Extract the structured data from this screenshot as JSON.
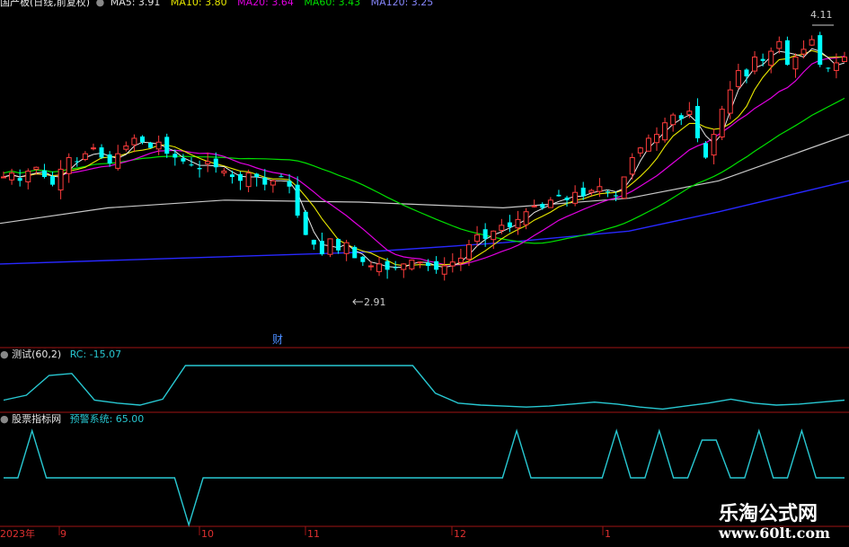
{
  "main_panel": {
    "title": "国产板(日线,前复权)",
    "ma_items": [
      {
        "label": "MA5: 3.91",
        "color": "#e8e8e8"
      },
      {
        "label": "MA10: 3.80",
        "color": "#e8e800"
      },
      {
        "label": "MA20: 3.64",
        "color": "#e000e0"
      },
      {
        "label": "MA60: 3.43",
        "color": "#00e000"
      },
      {
        "label": "MA120: 3.25",
        "color": "#8888ff"
      }
    ],
    "high_label": "4.11",
    "low_label": "2.91",
    "fin_marker": "财"
  },
  "rc_panel": {
    "title": "测试(60,2)",
    "value_label": "RC: -15.07",
    "color": "#28c8d2"
  },
  "warn_panel": {
    "title": "股票指标网",
    "value_label": "预警系统: 65.00",
    "color": "#28c8d2"
  },
  "time_axis": {
    "labels": [
      "2023年",
      "9",
      "10",
      "11",
      "12",
      "1"
    ]
  },
  "watermark": {
    "line1": "乐淘公式网",
    "line2": "www.60lt.com"
  },
  "colors": {
    "up": "#ff3c3c",
    "down": "#00ffff",
    "grid": "#a01414",
    "ma5": "#e8e8e8",
    "ma10": "#e8e800",
    "ma20": "#e000e0",
    "ma60": "#00e000",
    "ma120": "#2828ff",
    "ma250": "#c8c8c8",
    "indicator": "#28c8d2"
  },
  "chart_data": [
    {
      "type": "candlestick",
      "title": "国产板(日线,前复权)",
      "x_labels": [
        "2023年",
        "9",
        "10",
        "11",
        "12",
        "1"
      ],
      "y_labels_shown": [
        "4.11",
        "2.91"
      ],
      "close_path": [
        3.4,
        3.42,
        3.38,
        3.43,
        3.45,
        3.4,
        3.36,
        3.44,
        3.5,
        3.48,
        3.52,
        3.55,
        3.5,
        3.47,
        3.52,
        3.56,
        3.6,
        3.58,
        3.55,
        3.58,
        3.52,
        3.5,
        3.48,
        3.46,
        3.44,
        3.48,
        3.45,
        3.43,
        3.4,
        3.38,
        3.42,
        3.4,
        3.36,
        3.38,
        3.4,
        3.35,
        3.2,
        3.1,
        3.05,
        3.0,
        3.08,
        3.02,
        3.06,
        2.98,
        2.96,
        2.94,
        2.95,
        2.92,
        2.93,
        2.95,
        2.97,
        2.96,
        2.94,
        2.92,
        2.94,
        2.96,
        2.98,
        3.05,
        3.1,
        3.08,
        3.12,
        3.15,
        3.14,
        3.18,
        3.22,
        3.25,
        3.24,
        3.28,
        3.3,
        3.28,
        3.32,
        3.3,
        3.33,
        3.35,
        3.32,
        3.3,
        3.4,
        3.5,
        3.55,
        3.6,
        3.62,
        3.68,
        3.72,
        3.7,
        3.74,
        3.6,
        3.5,
        3.62,
        3.75,
        3.85,
        3.95,
        3.92,
        4.02,
        4.0,
        4.05,
        4.1,
        3.98,
        4.02,
        4.06,
        4.11,
        3.98,
        3.96,
        3.99,
        4.02
      ],
      "series_lines": [
        "MA5",
        "MA10",
        "MA20",
        "MA60",
        "MA120",
        "MA250"
      ]
    },
    {
      "type": "line",
      "title": "测试(60,2)",
      "series": [
        {
          "name": "RC",
          "values": [
            -15,
            -10,
            10,
            12,
            -15,
            -18,
            -20,
            -14,
            20,
            20,
            20,
            20,
            20,
            20,
            20,
            20,
            20,
            20,
            20,
            -8,
            -18,
            -20,
            -21,
            -22,
            -21,
            -19,
            -17,
            -19,
            -22,
            -24,
            -21,
            -18,
            -14,
            -18,
            -20,
            -19,
            -17,
            -15
          ]
        }
      ]
    },
    {
      "type": "line",
      "title": "股票指标网",
      "series": [
        {
          "name": "预警系统",
          "values": [
            0,
            0,
            50,
            0,
            0,
            0,
            0,
            0,
            0,
            0,
            0,
            0,
            0,
            -50,
            0,
            0,
            0,
            0,
            0,
            0,
            0,
            0,
            0,
            0,
            0,
            0,
            0,
            0,
            0,
            0,
            0,
            0,
            0,
            0,
            0,
            0,
            50,
            0,
            0,
            0,
            0,
            0,
            0,
            50,
            0,
            0,
            50,
            0,
            0,
            40,
            40,
            0,
            0,
            50,
            0,
            0,
            50,
            0,
            0,
            0
          ]
        }
      ]
    }
  ]
}
